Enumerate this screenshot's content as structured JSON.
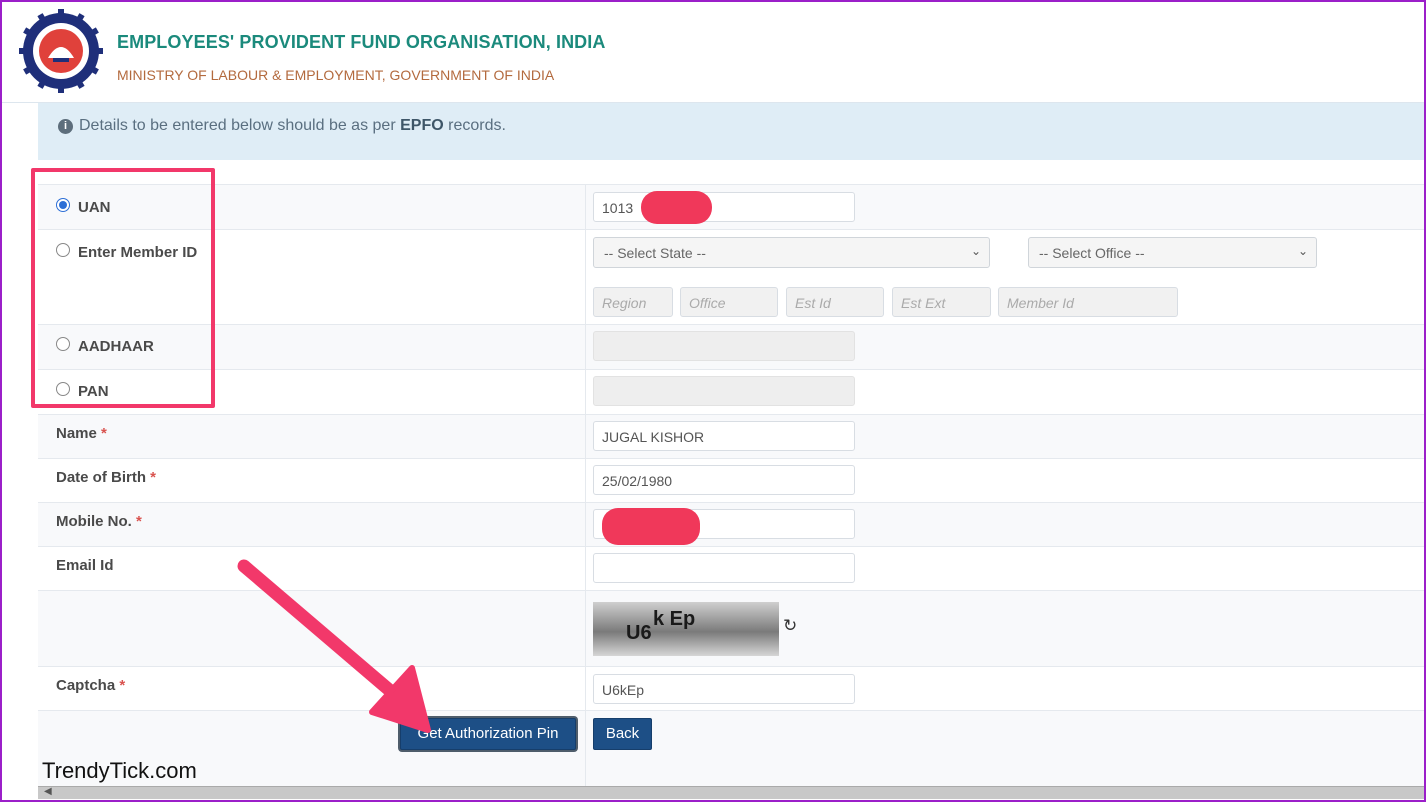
{
  "header": {
    "org_name": "EMPLOYEES' PROVIDENT FUND ORGANISATION, INDIA",
    "ministry": "MINISTRY OF LABOUR & EMPLOYMENT, GOVERNMENT OF INDIA"
  },
  "info": {
    "icon": "info-circle-icon",
    "text_before": "Details to be entered below should be as per",
    "text_bold": "EPFO",
    "text_after": "records."
  },
  "options": {
    "uan_label": "UAN",
    "member_id_label": "Enter Member ID",
    "aadhaar_label": "AADHAAR",
    "pan_label": "PAN",
    "selected": "UAN"
  },
  "uan": {
    "value": "1013"
  },
  "member_id": {
    "state_placeholder": "-- Select State --",
    "office_placeholder": "-- Select Office --",
    "region_placeholder": "Region",
    "office_field_placeholder": "Office",
    "est_id_placeholder": "Est Id",
    "est_ext_placeholder": "Est Ext",
    "member_id_placeholder": "Member Id"
  },
  "fields": {
    "name_label": "Name",
    "name_value": "JUGAL KISHOR",
    "dob_label": "Date of Birth",
    "dob_value": "25/02/1980",
    "mobile_label": "Mobile No.",
    "mobile_value": "",
    "email_label": "Email Id",
    "email_value": "",
    "captcha_label": "Captcha",
    "captcha_value": "U6kEp",
    "required_mark": "*"
  },
  "captcha_image": {
    "part1": "U6",
    "part2": "k Ep"
  },
  "buttons": {
    "get_pin": "Get Authorization Pin",
    "back": "Back"
  },
  "watermark": "TrendyTick.com",
  "colors": {
    "frame": "#9b1fc9",
    "highlight": "#f2386a",
    "button": "#1d4f86",
    "org_name": "#1b8a7c",
    "ministry": "#b36a3e"
  }
}
